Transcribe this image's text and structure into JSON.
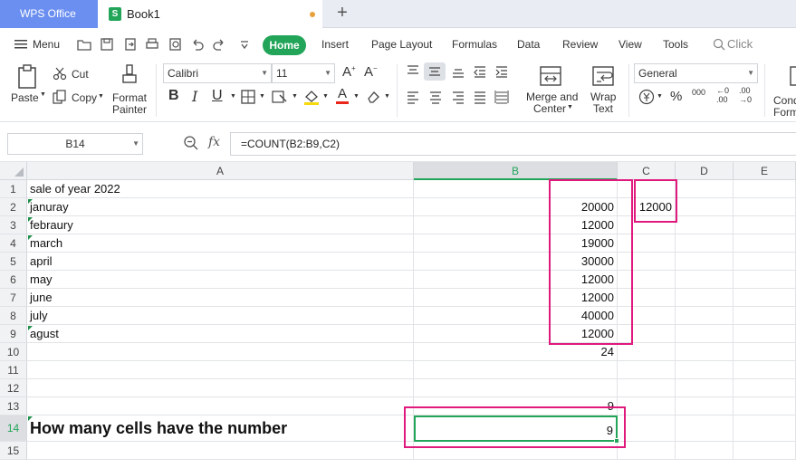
{
  "titlebar": {
    "app_tab": "WPS Office",
    "doc_icon_letter": "S",
    "doc_name": "Book1",
    "add_tab": "+"
  },
  "menu": {
    "menu_label": "Menu",
    "tabs": [
      "Home",
      "Insert",
      "Page Layout",
      "Formulas",
      "Data",
      "Review",
      "View",
      "Tools"
    ],
    "search_placeholder": "Click to find c"
  },
  "ribbon": {
    "paste": "Paste",
    "cut": "Cut",
    "copy": "Copy",
    "format_painter_1": "Format",
    "format_painter_2": "Painter",
    "font_name": "Calibri",
    "font_size": "11",
    "merge_1": "Merge and",
    "merge_2": "Center",
    "wrap_1": "Wrap",
    "wrap_2": "Text",
    "number_format": "General",
    "cond_1": "Cond",
    "cond_2": "Form",
    "bold": "B",
    "italic": "I",
    "underline": "U",
    "percent": "%",
    "thousands": "000",
    "inc_decimal": ".00",
    "dec_decimal": ".00"
  },
  "formula_bar": {
    "name_box": "B14",
    "fx": "fx",
    "formula": "=COUNT(B2:B9,C2)"
  },
  "sheet": {
    "columns": [
      "A",
      "B",
      "C",
      "D",
      "E"
    ],
    "selected_column": "B",
    "selected_row": "14",
    "rows": [
      {
        "num": "1",
        "a": "sale of year 2022",
        "b": "",
        "c": ""
      },
      {
        "num": "2",
        "a": "januray",
        "b": "20000",
        "c": "12000"
      },
      {
        "num": "3",
        "a": "febraury",
        "b": "12000",
        "c": ""
      },
      {
        "num": "4",
        "a": "march",
        "b": "19000",
        "c": ""
      },
      {
        "num": "5",
        "a": "april",
        "b": "30000",
        "c": ""
      },
      {
        "num": "6",
        "a": "may",
        "b": "12000",
        "c": ""
      },
      {
        "num": "7",
        "a": "june",
        "b": "12000",
        "c": ""
      },
      {
        "num": "8",
        "a": "july",
        "b": "40000",
        "c": ""
      },
      {
        "num": "9",
        "a": "agust",
        "b": "12000",
        "c": ""
      },
      {
        "num": "10",
        "a": "",
        "b": "24",
        "c": ""
      },
      {
        "num": "11",
        "a": "",
        "b": "",
        "c": ""
      },
      {
        "num": "12",
        "a": "",
        "b": "",
        "c": ""
      },
      {
        "num": "13",
        "a": "",
        "b": "9",
        "c": ""
      },
      {
        "num": "14",
        "a": "How many cells have the number",
        "b": "9",
        "c": ""
      },
      {
        "num": "15",
        "a": "",
        "b": "",
        "c": ""
      }
    ]
  },
  "colors": {
    "accent_green": "#22a559",
    "highlight_pink": "#e0197d",
    "app_tab_blue": "#6b8ff0"
  }
}
